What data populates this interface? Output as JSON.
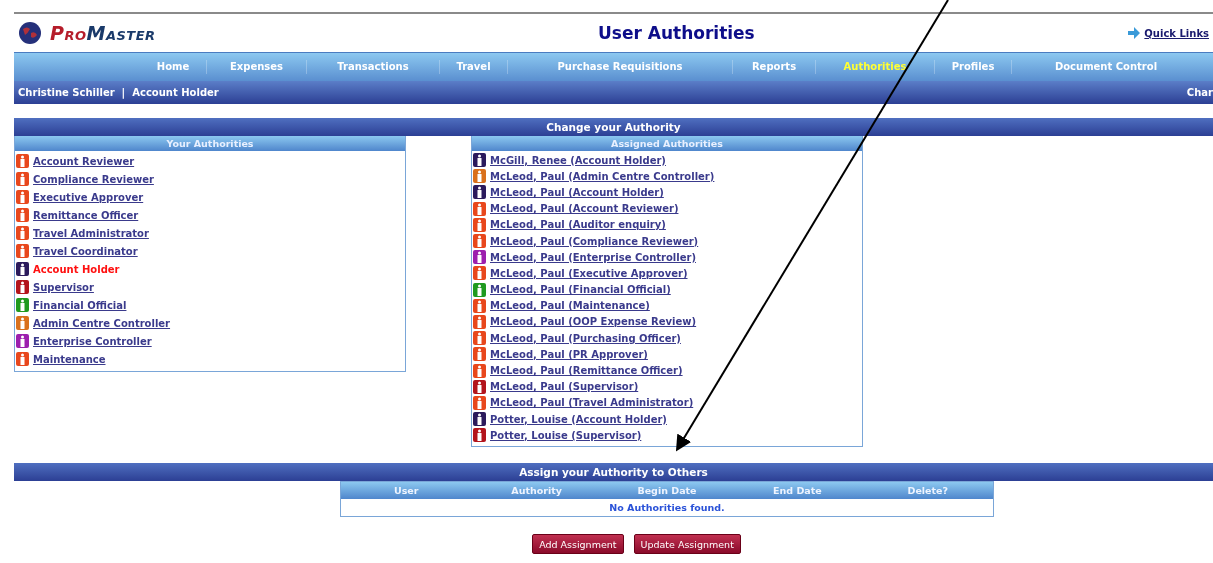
{
  "logo": {
    "parts": [
      "Pro",
      "Master"
    ]
  },
  "page_title": "User Authorities",
  "quick_links": "Quick Links",
  "nav": [
    {
      "label": "Home",
      "selected": false
    },
    {
      "label": "Expenses",
      "selected": false
    },
    {
      "label": "Transactions",
      "selected": false
    },
    {
      "label": "Travel",
      "selected": false
    },
    {
      "label": "Purchase Requisitions",
      "selected": false
    },
    {
      "label": "Reports",
      "selected": false
    },
    {
      "label": "Authorities",
      "selected": true
    },
    {
      "label": "Profiles",
      "selected": false
    },
    {
      "label": "Document Control",
      "selected": false
    }
  ],
  "user_bar": {
    "user": "Christine Schiller",
    "separator": "|",
    "role": "Account Holder",
    "right_text": "Char"
  },
  "change_section": {
    "title": "Change your Authority",
    "your_authorities": {
      "title": "Your Authorities",
      "items": [
        {
          "label": "Account Reviewer",
          "color": "#e8471c",
          "current": false
        },
        {
          "label": "Compliance Reviewer",
          "color": "#e8471c",
          "current": false
        },
        {
          "label": "Executive Approver",
          "color": "#e8471c",
          "current": false
        },
        {
          "label": "Remittance Officer",
          "color": "#e8471c",
          "current": false
        },
        {
          "label": "Travel Administrator",
          "color": "#e8471c",
          "current": false
        },
        {
          "label": "Travel Coordinator",
          "color": "#e8471c",
          "current": false
        },
        {
          "label": "Account Holder",
          "color": "#2b1a5c",
          "current": true
        },
        {
          "label": "Supervisor",
          "color": "#b3141c",
          "current": false
        },
        {
          "label": "Financial Official",
          "color": "#1f9a1f",
          "current": false
        },
        {
          "label": "Admin Centre Controller",
          "color": "#d9701c",
          "current": false
        },
        {
          "label": "Enterprise Controller",
          "color": "#9c1fae",
          "current": false
        },
        {
          "label": "Maintenance",
          "color": "#e8471c",
          "current": false
        }
      ]
    },
    "assigned_authorities": {
      "title": "Assigned Authorities",
      "items": [
        {
          "label": "McGill, Renee (Account Holder)",
          "color": "#2b1a5c"
        },
        {
          "label": "McLeod, Paul (Admin Centre Controller)",
          "color": "#d9701c"
        },
        {
          "label": "McLeod, Paul (Account Holder)",
          "color": "#2b1a5c"
        },
        {
          "label": "McLeod, Paul (Account Reviewer)",
          "color": "#e8471c"
        },
        {
          "label": "McLeod, Paul (Auditor enquiry)",
          "color": "#e8471c"
        },
        {
          "label": "McLeod, Paul (Compliance Reviewer)",
          "color": "#e8471c"
        },
        {
          "label": "McLeod, Paul (Enterprise Controller)",
          "color": "#9c1fae"
        },
        {
          "label": "McLeod, Paul (Executive Approver)",
          "color": "#e8471c"
        },
        {
          "label": "McLeod, Paul (Financial Official)",
          "color": "#1f9a1f"
        },
        {
          "label": "McLeod, Paul (Maintenance)",
          "color": "#e8471c"
        },
        {
          "label": "McLeod, Paul (OOP Expense Review)",
          "color": "#e8471c"
        },
        {
          "label": "McLeod, Paul (Purchasing Officer)",
          "color": "#e8471c"
        },
        {
          "label": "McLeod, Paul (PR Approver)",
          "color": "#e8471c"
        },
        {
          "label": "McLeod, Paul (Remittance Officer)",
          "color": "#e8471c"
        },
        {
          "label": "McLeod, Paul (Supervisor)",
          "color": "#b3141c"
        },
        {
          "label": "McLeod, Paul (Travel Administrator)",
          "color": "#e8471c"
        },
        {
          "label": "Potter, Louise (Account Holder)",
          "color": "#2b1a5c"
        },
        {
          "label": "Potter, Louise (Supervisor)",
          "color": "#b3141c"
        }
      ]
    }
  },
  "assign_section": {
    "title": "Assign your Authority to Others",
    "table": {
      "columns": [
        "User",
        "Authority",
        "Begin Date",
        "End Date",
        "Delete?"
      ],
      "empty_message": "No Authorities found."
    },
    "buttons": [
      "Add Assignment",
      "Update Assignment"
    ]
  }
}
